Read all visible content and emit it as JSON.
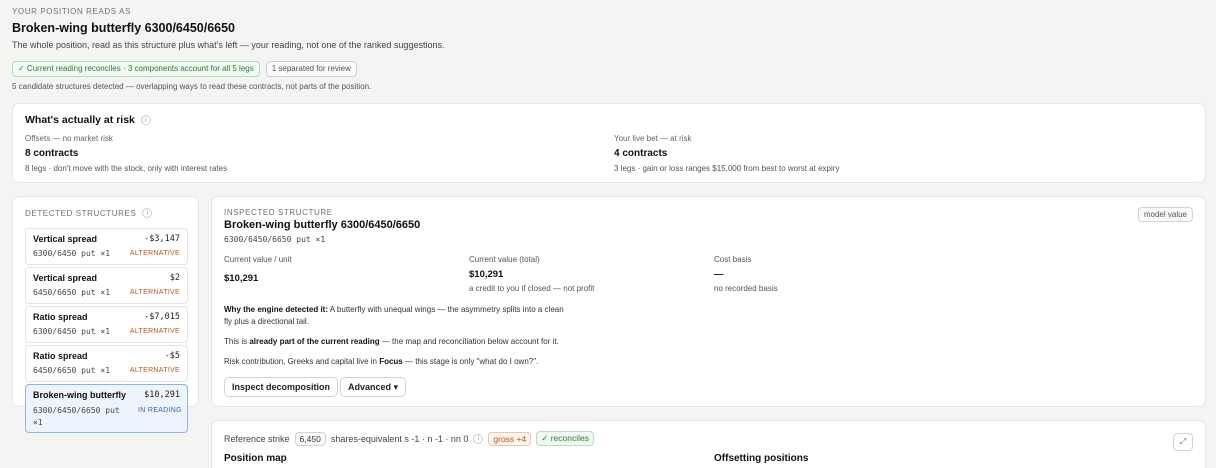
{
  "header": {
    "eyebrow": "YOUR POSITION READS AS",
    "title": "Broken-wing butterfly 6300/6450/6650",
    "description": "The whole position, read as this structure plus what's left — your reading, not one of the ranked suggestions.",
    "chip_reconciles": "✓ Current reading reconciles · 3 components account for all 5 legs",
    "chip_review": "1 separated for review",
    "note": "5 candidate structures detected — overlapping ways to read these contracts, not parts of the position."
  },
  "risk": {
    "title": "What's actually at risk",
    "info_icon": "i",
    "offsets": {
      "label": "Offsets — no market risk",
      "value": "8 contracts",
      "sub": "8 legs · don't move with the stock, only with interest rates"
    },
    "live": {
      "label": "Your live bet — at risk",
      "value": "4 contracts",
      "sub": "3 legs · gain or loss ranges $15,000 from best to worst at expiry"
    }
  },
  "detected": {
    "title": "DETECTED STRUCTURES",
    "info_icon": "i",
    "items": [
      {
        "name": "Vertical spread",
        "legs": "6300/6450 put ×1",
        "amount": "-$3,147",
        "tag": "ALTERNATIVE"
      },
      {
        "name": "Vertical spread",
        "legs": "6450/6650 put ×1",
        "amount": "$2",
        "tag": "ALTERNATIVE"
      },
      {
        "name": "Ratio spread",
        "legs": "6300/6450 put ×1",
        "amount": "-$7,015",
        "tag": "ALTERNATIVE"
      },
      {
        "name": "Ratio spread",
        "legs": "6450/6650 put ×1",
        "amount": "-$5",
        "tag": "ALTERNATIVE"
      },
      {
        "name": "Broken-wing butterfly",
        "legs": "6300/6450/6650 put ×1",
        "amount": "$10,291",
        "tag": "IN READING"
      }
    ]
  },
  "inspected": {
    "eyebrow": "INSPECTED STRUCTURE",
    "title": "Broken-wing butterfly 6300/6450/6650",
    "subtitle": "6300/6450/6650 put ×1",
    "badge": "model value",
    "unit_label": "Current value / unit",
    "unit_value": "$10,291",
    "total_label": "Current value (total)",
    "total_value": "$10,291",
    "total_sub": "a credit to you if closed — not profit",
    "cost_label": "Cost basis",
    "cost_value": "—",
    "cost_sub": "no recorded basis",
    "why_bold": "Why the engine detected it:",
    "why_text": " A butterfly with unequal wings — the asymmetry splits into a clean fly plus a directional tail.",
    "part_pre": "This is ",
    "part_bold": "already part of the current reading",
    "part_post": " — the map and reconciliation below account for it.",
    "risk_pre": "Risk contribution, Greeks and capital live in ",
    "risk_bold": "Focus",
    "risk_post": " — this stage is only \"what do I own?\".",
    "btn_inspect": "Inspect decomposition",
    "btn_advanced": "Advanced ▾"
  },
  "bottom": {
    "ref_label": "Reference strike",
    "ref_value": "6,450",
    "shares_label": "shares-equivalent s -1 · n -1 · nn 0",
    "info_icon": "i",
    "gross": "gross +4",
    "reconciles": "✓ reconciles",
    "position_map": "Position map",
    "offsetting": "Offsetting positions",
    "expand_icon": "⤢"
  }
}
